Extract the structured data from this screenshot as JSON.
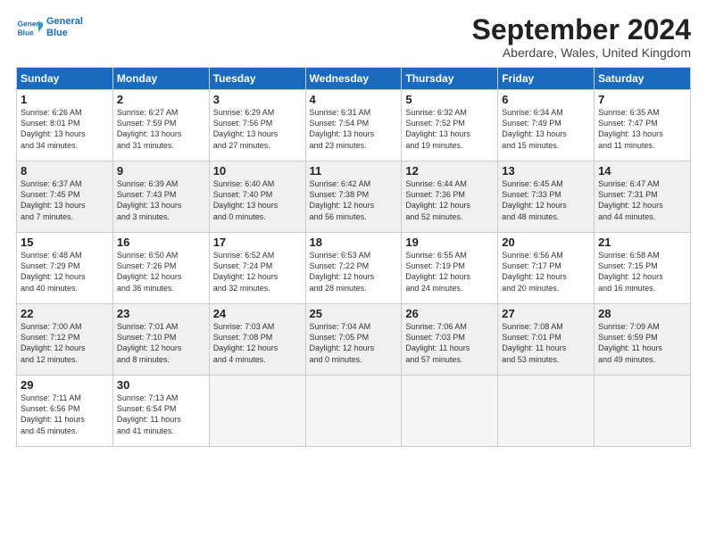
{
  "header": {
    "logo_line1": "General",
    "logo_line2": "Blue",
    "title": "September 2024",
    "location": "Aberdare, Wales, United Kingdom"
  },
  "weekdays": [
    "Sunday",
    "Monday",
    "Tuesday",
    "Wednesday",
    "Thursday",
    "Friday",
    "Saturday"
  ],
  "weeks": [
    [
      {
        "day": "1",
        "lines": [
          "Sunrise: 6:26 AM",
          "Sunset: 8:01 PM",
          "Daylight: 13 hours",
          "and 34 minutes."
        ]
      },
      {
        "day": "2",
        "lines": [
          "Sunrise: 6:27 AM",
          "Sunset: 7:59 PM",
          "Daylight: 13 hours",
          "and 31 minutes."
        ]
      },
      {
        "day": "3",
        "lines": [
          "Sunrise: 6:29 AM",
          "Sunset: 7:56 PM",
          "Daylight: 13 hours",
          "and 27 minutes."
        ]
      },
      {
        "day": "4",
        "lines": [
          "Sunrise: 6:31 AM",
          "Sunset: 7:54 PM",
          "Daylight: 13 hours",
          "and 23 minutes."
        ]
      },
      {
        "day": "5",
        "lines": [
          "Sunrise: 6:32 AM",
          "Sunset: 7:52 PM",
          "Daylight: 13 hours",
          "and 19 minutes."
        ]
      },
      {
        "day": "6",
        "lines": [
          "Sunrise: 6:34 AM",
          "Sunset: 7:49 PM",
          "Daylight: 13 hours",
          "and 15 minutes."
        ]
      },
      {
        "day": "7",
        "lines": [
          "Sunrise: 6:35 AM",
          "Sunset: 7:47 PM",
          "Daylight: 13 hours",
          "and 11 minutes."
        ]
      }
    ],
    [
      {
        "day": "8",
        "lines": [
          "Sunrise: 6:37 AM",
          "Sunset: 7:45 PM",
          "Daylight: 13 hours",
          "and 7 minutes."
        ]
      },
      {
        "day": "9",
        "lines": [
          "Sunrise: 6:39 AM",
          "Sunset: 7:43 PM",
          "Daylight: 13 hours",
          "and 3 minutes."
        ]
      },
      {
        "day": "10",
        "lines": [
          "Sunrise: 6:40 AM",
          "Sunset: 7:40 PM",
          "Daylight: 13 hours",
          "and 0 minutes."
        ]
      },
      {
        "day": "11",
        "lines": [
          "Sunrise: 6:42 AM",
          "Sunset: 7:38 PM",
          "Daylight: 12 hours",
          "and 56 minutes."
        ]
      },
      {
        "day": "12",
        "lines": [
          "Sunrise: 6:44 AM",
          "Sunset: 7:36 PM",
          "Daylight: 12 hours",
          "and 52 minutes."
        ]
      },
      {
        "day": "13",
        "lines": [
          "Sunrise: 6:45 AM",
          "Sunset: 7:33 PM",
          "Daylight: 12 hours",
          "and 48 minutes."
        ]
      },
      {
        "day": "14",
        "lines": [
          "Sunrise: 6:47 AM",
          "Sunset: 7:31 PM",
          "Daylight: 12 hours",
          "and 44 minutes."
        ]
      }
    ],
    [
      {
        "day": "15",
        "lines": [
          "Sunrise: 6:48 AM",
          "Sunset: 7:29 PM",
          "Daylight: 12 hours",
          "and 40 minutes."
        ]
      },
      {
        "day": "16",
        "lines": [
          "Sunrise: 6:50 AM",
          "Sunset: 7:26 PM",
          "Daylight: 12 hours",
          "and 36 minutes."
        ]
      },
      {
        "day": "17",
        "lines": [
          "Sunrise: 6:52 AM",
          "Sunset: 7:24 PM",
          "Daylight: 12 hours",
          "and 32 minutes."
        ]
      },
      {
        "day": "18",
        "lines": [
          "Sunrise: 6:53 AM",
          "Sunset: 7:22 PM",
          "Daylight: 12 hours",
          "and 28 minutes."
        ]
      },
      {
        "day": "19",
        "lines": [
          "Sunrise: 6:55 AM",
          "Sunset: 7:19 PM",
          "Daylight: 12 hours",
          "and 24 minutes."
        ]
      },
      {
        "day": "20",
        "lines": [
          "Sunrise: 6:56 AM",
          "Sunset: 7:17 PM",
          "Daylight: 12 hours",
          "and 20 minutes."
        ]
      },
      {
        "day": "21",
        "lines": [
          "Sunrise: 6:58 AM",
          "Sunset: 7:15 PM",
          "Daylight: 12 hours",
          "and 16 minutes."
        ]
      }
    ],
    [
      {
        "day": "22",
        "lines": [
          "Sunrise: 7:00 AM",
          "Sunset: 7:12 PM",
          "Daylight: 12 hours",
          "and 12 minutes."
        ]
      },
      {
        "day": "23",
        "lines": [
          "Sunrise: 7:01 AM",
          "Sunset: 7:10 PM",
          "Daylight: 12 hours",
          "and 8 minutes."
        ]
      },
      {
        "day": "24",
        "lines": [
          "Sunrise: 7:03 AM",
          "Sunset: 7:08 PM",
          "Daylight: 12 hours",
          "and 4 minutes."
        ]
      },
      {
        "day": "25",
        "lines": [
          "Sunrise: 7:04 AM",
          "Sunset: 7:05 PM",
          "Daylight: 12 hours",
          "and 0 minutes."
        ]
      },
      {
        "day": "26",
        "lines": [
          "Sunrise: 7:06 AM",
          "Sunset: 7:03 PM",
          "Daylight: 11 hours",
          "and 57 minutes."
        ]
      },
      {
        "day": "27",
        "lines": [
          "Sunrise: 7:08 AM",
          "Sunset: 7:01 PM",
          "Daylight: 11 hours",
          "and 53 minutes."
        ]
      },
      {
        "day": "28",
        "lines": [
          "Sunrise: 7:09 AM",
          "Sunset: 6:59 PM",
          "Daylight: 11 hours",
          "and 49 minutes."
        ]
      }
    ],
    [
      {
        "day": "29",
        "lines": [
          "Sunrise: 7:11 AM",
          "Sunset: 6:56 PM",
          "Daylight: 11 hours",
          "and 45 minutes."
        ]
      },
      {
        "day": "30",
        "lines": [
          "Sunrise: 7:13 AM",
          "Sunset: 6:54 PM",
          "Daylight: 11 hours",
          "and 41 minutes."
        ]
      },
      {
        "day": "",
        "lines": []
      },
      {
        "day": "",
        "lines": []
      },
      {
        "day": "",
        "lines": []
      },
      {
        "day": "",
        "lines": []
      },
      {
        "day": "",
        "lines": []
      }
    ]
  ]
}
